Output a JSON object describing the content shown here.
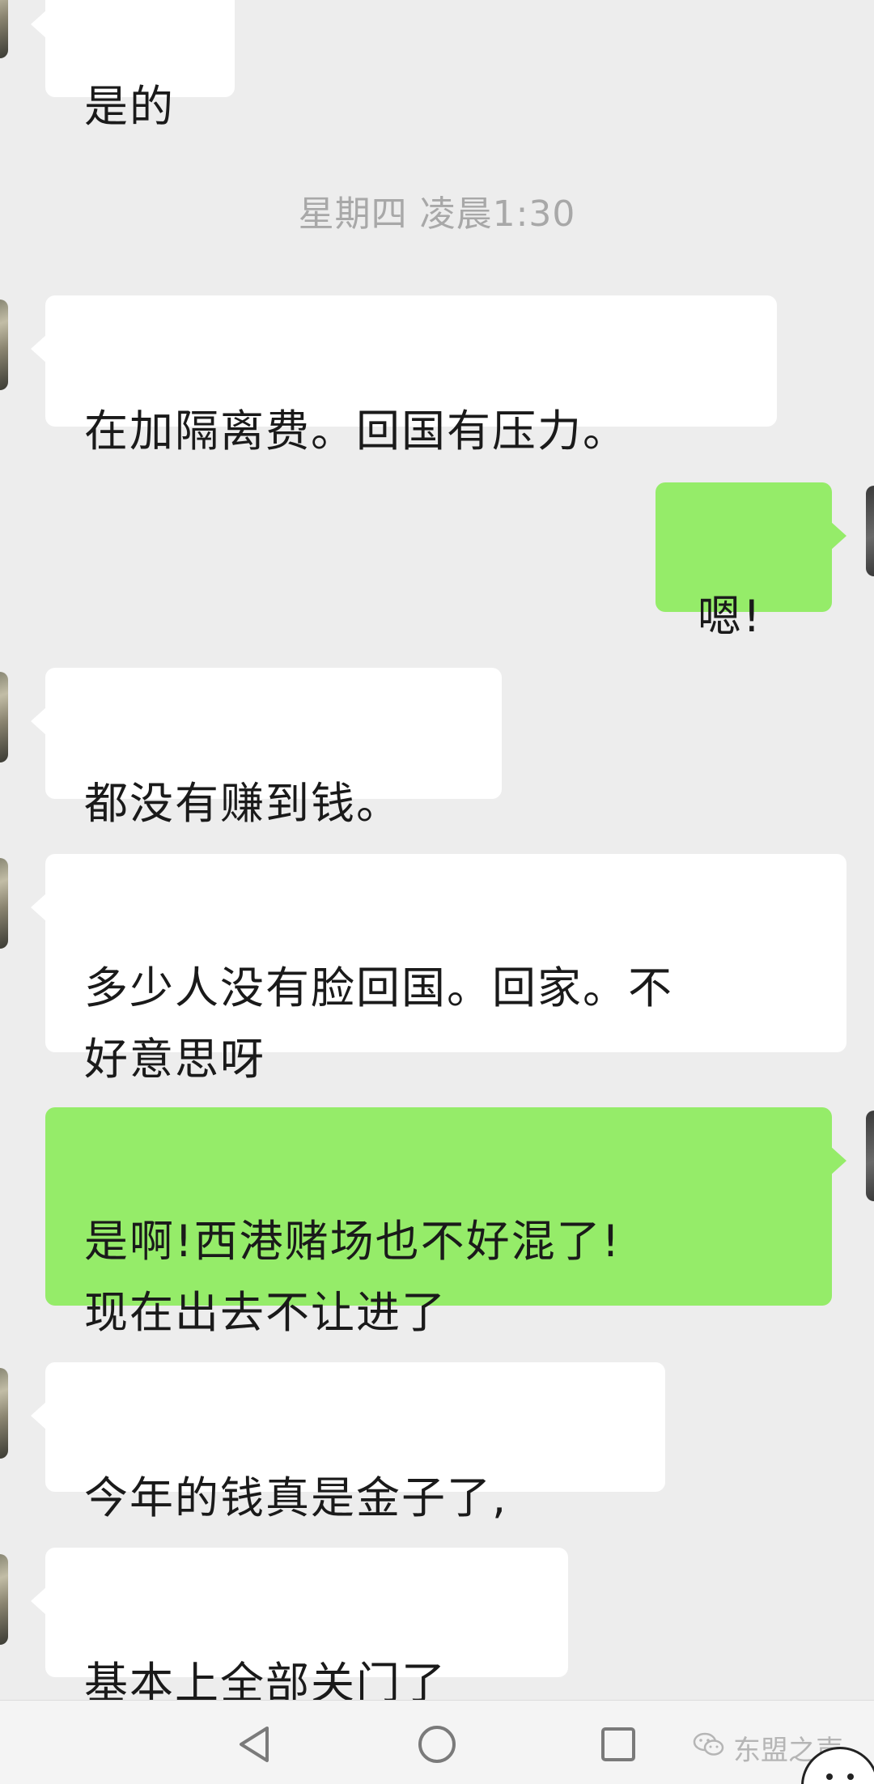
{
  "timestamp": "星期四 凌晨1:30",
  "messages": [
    {
      "side": "in",
      "text": "是的"
    },
    {
      "side": "in",
      "text": "在加隔离费。回国有压力。"
    },
    {
      "side": "out",
      "text": "嗯!"
    },
    {
      "side": "in",
      "text": "都没有赚到钱。"
    },
    {
      "side": "in",
      "text": "多少人没有脸回国。回家。不\n好意思呀"
    },
    {
      "side": "out",
      "text": "是啊!西港赌场也不好混了!\n现在出去不让进了"
    },
    {
      "side": "in",
      "text": "今年的钱真是金子了,"
    },
    {
      "side": "in",
      "text": "基本上全部关门了"
    }
  ],
  "nav": {
    "back_icon": "back-triangle-icon",
    "home_icon": "home-circle-icon",
    "recents_icon": "recents-square-icon"
  },
  "watermark": {
    "text": "东盟之声",
    "icon": "wechat-icon"
  },
  "colors": {
    "background": "#ededed",
    "incoming_bubble": "#ffffff",
    "outgoing_bubble": "#95ec69",
    "timestamp_text": "#a8a8a8"
  }
}
